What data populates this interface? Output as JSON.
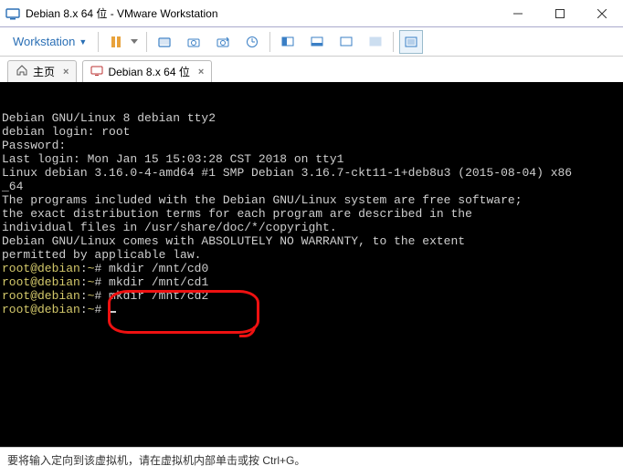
{
  "window": {
    "title": "Debian 8.x 64 位 - VMware Workstation"
  },
  "menubar": {
    "workstation_label": "Workstation"
  },
  "tabs": {
    "home_label": "主页",
    "vm_label": "Debian 8.x 64 位"
  },
  "terminal": {
    "lines": [
      "",
      "Debian GNU/Linux 8 debian tty2",
      "",
      "debian login: root",
      "Password:",
      "Last login: Mon Jan 15 15:03:28 CST 2018 on tty1",
      "Linux debian 3.16.0-4-amd64 #1 SMP Debian 3.16.7-ckt11-1+deb8u3 (2015-08-04) x86",
      "_64",
      "",
      "The programs included with the Debian GNU/Linux system are free software;",
      "the exact distribution terms for each program are described in the",
      "individual files in /usr/share/doc/*/copyright.",
      "",
      "Debian GNU/Linux comes with ABSOLUTELY NO WARRANTY, to the extent",
      "permitted by applicable law."
    ],
    "cmds": [
      {
        "prompt_user": "root@debian",
        "prompt_sep1": ":",
        "prompt_path": "~",
        "prompt_sep2": "# ",
        "cmd": "mkdir /mnt/cd0"
      },
      {
        "prompt_user": "root@debian",
        "prompt_sep1": ":",
        "prompt_path": "~",
        "prompt_sep2": "# ",
        "cmd": "mkdir /mnt/cd1"
      },
      {
        "prompt_user": "root@debian",
        "prompt_sep1": ":",
        "prompt_path": "~",
        "prompt_sep2": "# ",
        "cmd": "mkdir /mnt/cd2"
      },
      {
        "prompt_user": "root@debian",
        "prompt_sep1": ":",
        "prompt_path": "~",
        "prompt_sep2": "# ",
        "cmd": ""
      }
    ]
  },
  "statusbar": {
    "text": "要将输入定向到该虚拟机，请在虚拟机内部单击或按 Ctrl+G。"
  }
}
